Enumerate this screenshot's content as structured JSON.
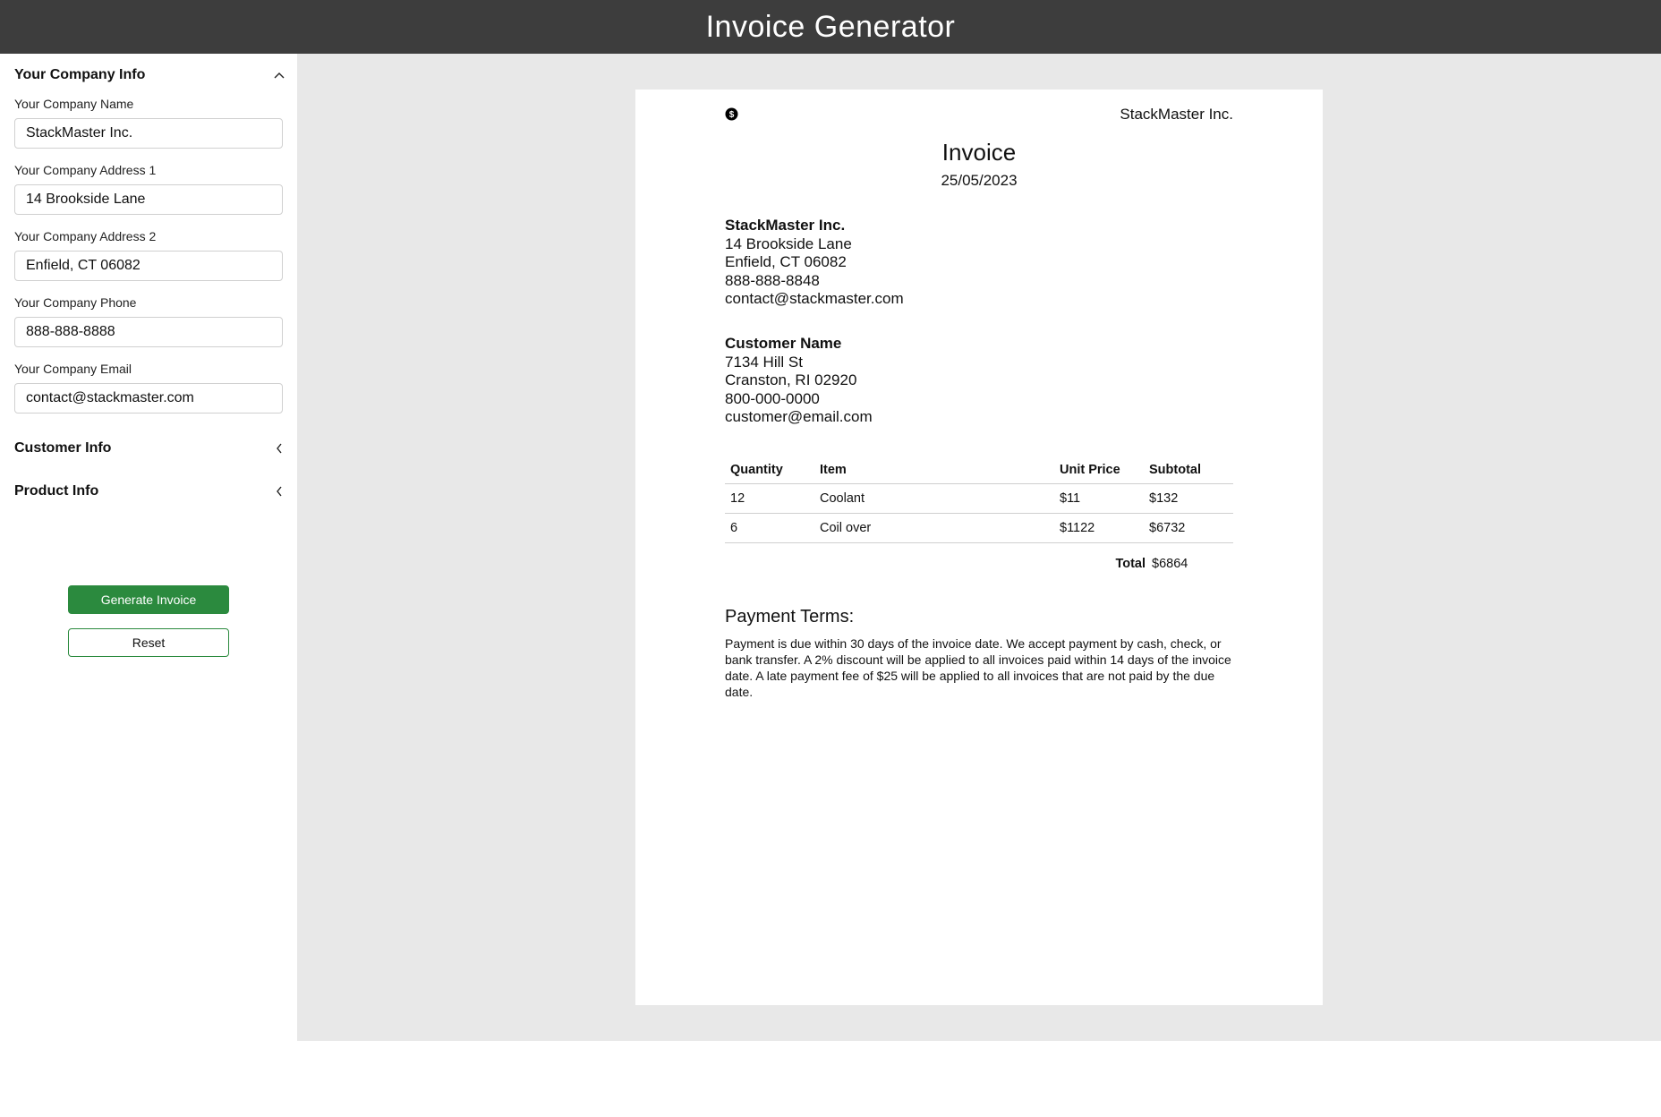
{
  "app": {
    "title": "Invoice Generator"
  },
  "sidebar": {
    "company_section": {
      "title": "Your Company Info",
      "expanded": true,
      "fields": [
        {
          "label": "Your Company Name",
          "value": "StackMaster Inc."
        },
        {
          "label": "Your Company Address 1",
          "value": "14 Brookside Lane"
        },
        {
          "label": "Your Company Address 2",
          "value": "Enfield, CT 06082"
        },
        {
          "label": "Your Company Phone",
          "value": "888-888-8888"
        },
        {
          "label": "Your Company Email",
          "value": "contact@stackmaster.com"
        }
      ]
    },
    "customer_section": {
      "title": "Customer Info",
      "expanded": false
    },
    "product_section": {
      "title": "Product Info",
      "expanded": false
    },
    "buttons": {
      "generate": "Generate Invoice",
      "reset": "Reset"
    }
  },
  "invoice": {
    "logo_icon": "dollar-coin-icon",
    "company_top": "StackMaster Inc.",
    "title": "Invoice",
    "date": "25/05/2023",
    "from": {
      "name": "StackMaster Inc.",
      "address1": "14 Brookside Lane",
      "address2": "Enfield, CT 06082",
      "phone": "888-888-8848",
      "email": "contact@stackmaster.com"
    },
    "to": {
      "name": "Customer Name",
      "address1": "7134 Hill St",
      "address2": "Cranston, RI 02920",
      "phone": "800-000-0000",
      "email": "customer@email.com"
    },
    "table": {
      "headers": [
        "Quantity",
        "Item",
        "Unit Price",
        "Subtotal"
      ],
      "rows": [
        [
          "12",
          "Coolant",
          "$11",
          "$132"
        ],
        [
          "6",
          "Coil over",
          "$1122",
          "$6732"
        ]
      ]
    },
    "total_label": "Total",
    "total_value": "$6864",
    "terms_title": "Payment Terms:",
    "terms_body": "Payment is due within 30 days of the invoice date. We accept payment by cash, check, or bank transfer. A 2% discount will be applied to all invoices paid within 14 days of the invoice date. A late payment fee of $25 will be applied to all invoices that are not paid by the due date."
  },
  "colors": {
    "header_bg": "#3d3d3d",
    "accent_green": "#2b8a3e",
    "canvas_bg": "#e8e8e8"
  }
}
